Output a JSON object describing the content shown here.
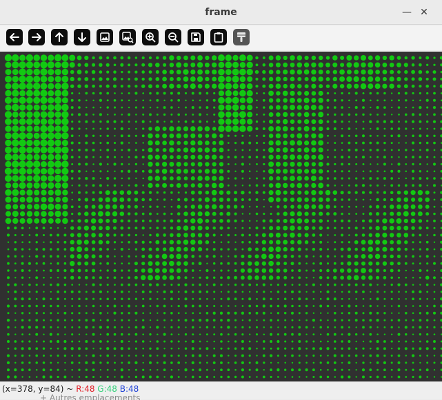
{
  "window": {
    "title": "frame",
    "minimize_glyph": "—",
    "close_glyph": "✕"
  },
  "toolbar": [
    {
      "name": "pan-left-button",
      "icon": "arrow-left-icon"
    },
    {
      "name": "pan-right-button",
      "icon": "arrow-right-icon"
    },
    {
      "name": "pan-up-button",
      "icon": "arrow-up-icon"
    },
    {
      "name": "pan-down-button",
      "icon": "arrow-down-icon"
    },
    {
      "name": "zoom-fit-button",
      "icon": "image-icon"
    },
    {
      "name": "zoom-original-button",
      "icon": "image-zoom-icon"
    },
    {
      "name": "zoom-in-button",
      "icon": "zoom-in-icon"
    },
    {
      "name": "zoom-out-button",
      "icon": "zoom-out-icon"
    },
    {
      "name": "save-button",
      "icon": "save-icon"
    },
    {
      "name": "copy-clipboard-button",
      "icon": "clipboard-icon"
    },
    {
      "name": "properties-button",
      "icon": "brush-icon",
      "disabled": true
    }
  ],
  "canvas": {
    "background": "#303030",
    "dot_color": "#12c912",
    "description_source": "halftone green dot pattern"
  },
  "status": {
    "coords": "(x=378, y=84) ~",
    "r": "R:48",
    "g": "G:48",
    "b": "B:48",
    "behind_text": "+ Autres emplacements"
  }
}
